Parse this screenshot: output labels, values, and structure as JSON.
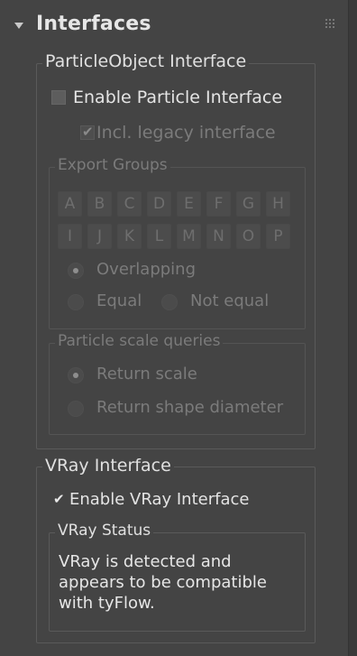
{
  "rollout": {
    "title": "Interfaces"
  },
  "particle_interface": {
    "group_title": "ParticleObject Interface",
    "enable_label": "Enable Particle Interface",
    "enable_checked": false,
    "legacy_label": "Incl. legacy interface",
    "legacy_checked": true,
    "export_groups": {
      "title": "Export Groups",
      "letters_row1": [
        "A",
        "B",
        "C",
        "D",
        "E",
        "F",
        "G",
        "H"
      ],
      "letters_row2": [
        "I",
        "J",
        "K",
        "L",
        "M",
        "N",
        "O",
        "P"
      ],
      "overlapping_label": "Overlapping",
      "equal_label": "Equal",
      "not_equal_label": "Not equal",
      "selected_mode": "Overlapping"
    },
    "scale_queries": {
      "title": "Particle scale queries",
      "return_scale_label": "Return scale",
      "return_diameter_label": "Return shape diameter",
      "selected": "Return scale"
    }
  },
  "vray_interface": {
    "group_title": "VRay Interface",
    "enable_label": "Enable VRay Interface",
    "enable_checked": true,
    "status": {
      "title": "VRay Status",
      "text": "VRay is detected and appears to be compatible with tyFlow."
    }
  },
  "colors": {
    "panel_bg": "#444444",
    "text": "#e4e4e4",
    "disabled_text": "#7b7b7b",
    "group_border": "#5a5a5a"
  }
}
